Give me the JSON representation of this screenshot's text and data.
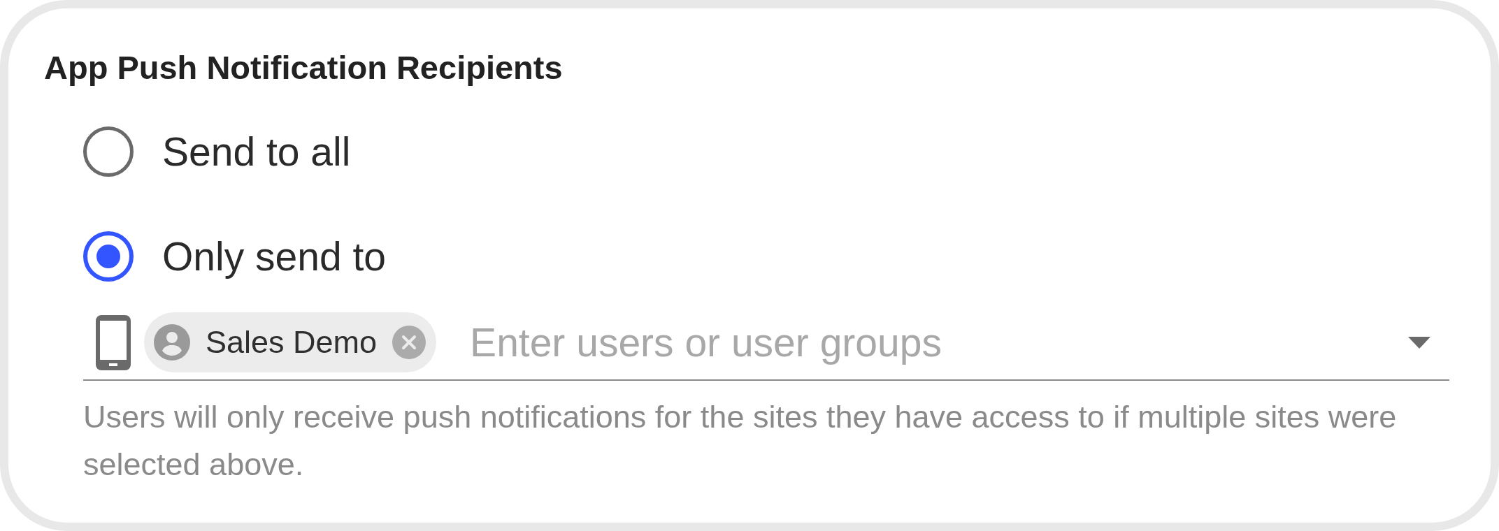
{
  "section": {
    "title": "App Push Notification Recipients"
  },
  "recipients": {
    "options": [
      {
        "label": "Send to all",
        "selected": false
      },
      {
        "label": "Only send to",
        "selected": true
      }
    ],
    "field": {
      "chips": [
        {
          "label": "Sales Demo"
        }
      ],
      "placeholder": "Enter users or user groups"
    },
    "helper_text": "Users will only receive push notifications for the sites they have access to if multiple sites were selected above."
  }
}
